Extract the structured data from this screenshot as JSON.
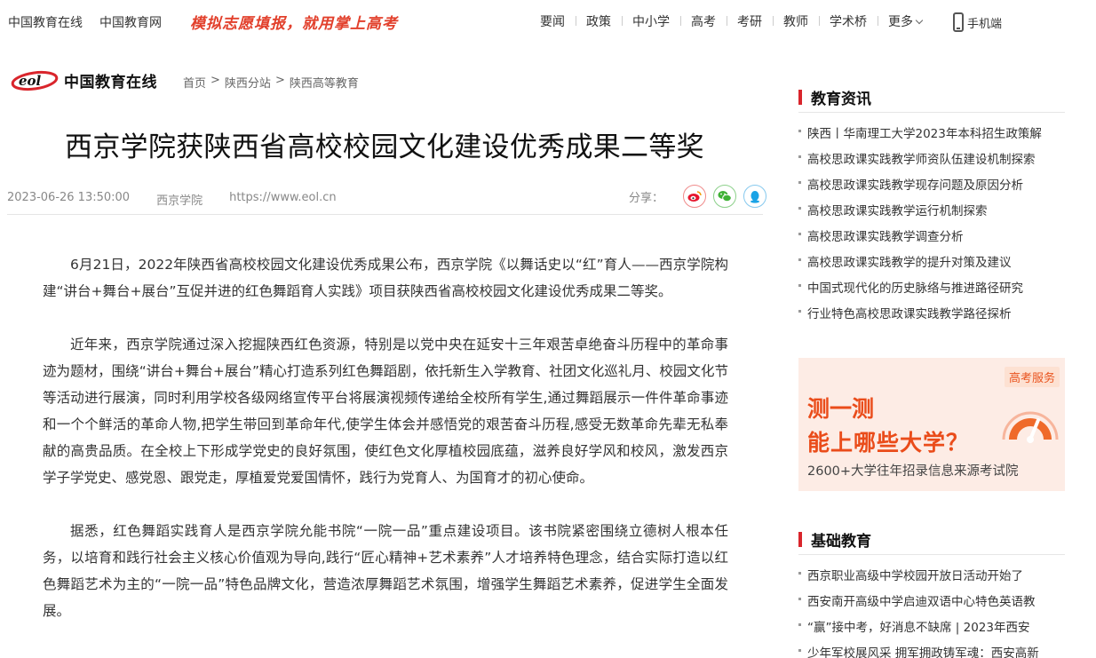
{
  "topbar": {
    "site1": "中国教育在线",
    "site2": "中国教育网",
    "slogan": "模拟志愿填报，就用掌上高考",
    "nav": [
      "要闻",
      "政策",
      "中小学",
      "高考",
      "考研",
      "教师",
      "学术桥",
      "更多"
    ],
    "mobile": "手机端"
  },
  "logo": {
    "mark": "eol",
    "text": "中国教育在线"
  },
  "breadcrumb": [
    "首页",
    "陕西分站",
    "陕西高等教育"
  ],
  "article": {
    "title": "西京学院获陕西省高校校园文化建设优秀成果二等奖",
    "date": "2023-06-26 13:50:00",
    "source": "西京学院",
    "url": "https://www.eol.cn",
    "share_label": "分享：",
    "paragraphs": [
      "6月21日，2022年陕西省高校校园文化建设优秀成果公布，西京学院《以舞话史以“红”育人——西京学院构建“讲台+舞台+展台”互促并进的红色舞蹈育人实践》项目获陕西省高校校园文化建设优秀成果二等奖。",
      "近年来，西京学院通过深入挖掘陕西红色资源，特别是以党中央在延安十三年艰苦卓绝奋斗历程中的革命事迹为题材，围绕“讲台+舞台+展台”精心打造系列红色舞蹈剧，依托新生入学教育、社团文化巡礼月、校园文化节等活动进行展演，同时利用学校各级网络宣传平台将展演视频传递给全校所有学生,通过舞蹈展示一件件革命事迹和一个个鲜活的革命人物,把学生带回到革命年代,使学生体会并感悟党的艰苦奋斗历程,感受无数革命先辈无私奉献的高贵品质。在全校上下形成学党史的良好氛围，使红色文化厚植校园底蕴，滋养良好学风和校风，激发西京学子学党史、感党恩、跟党走，厚植爱党爱国情怀，践行为党育人、为国育才的初心使命。",
      "据悉，红色舞蹈实践育人是西京学院允能书院“一院一品”重点建设项目。该书院紧密围绕立德树人根本任务，以培育和践行社会主义核心价值观为导向,践行“匠心精神+艺术素养”人才培养特色理念，结合实际打造以红色舞蹈艺术为主的“一院一品”特色品牌文化，营造浓厚舞蹈艺术氛围，增强学生舞蹈艺术素养，促进学生全面发展。"
    ]
  },
  "sidebar": {
    "news_title": "教育资讯",
    "news": [
      "陕西丨华南理工大学2023年本科招生政策解",
      "高校思政课实践教学师资队伍建设机制探索",
      "高校思政课实践教学现存问题及原因分析",
      "高校思政课实践教学运行机制探索",
      "高校思政课实践教学调查分析",
      "高校思政课实践教学的提升对策及建议",
      "中国式现代化的历史脉络与推进路径研究",
      "行业特色高校思政课实践教学路径探析"
    ],
    "ad": {
      "tag": "高考服务",
      "line1": "测一测",
      "line2": "能上哪些大学？",
      "line3": "2600+大学往年招录信息来源考试院"
    },
    "basic_title": "基础教育",
    "basic": [
      "西京职业高级中学校园开放日活动开始了",
      "西安南开高级中学启迪双语中心特色英语教",
      "“赢”接中考，好消息不缺席 | 2023年西安",
      "少年军校展风采 拥军拥政铸军魂：西安高新"
    ]
  },
  "colors": {
    "accent": "#d9252c",
    "weibo": "#e6162d",
    "wechat": "#3eb135",
    "qq": "#1aa3e6",
    "ad_orange": "#ea4c1a"
  }
}
